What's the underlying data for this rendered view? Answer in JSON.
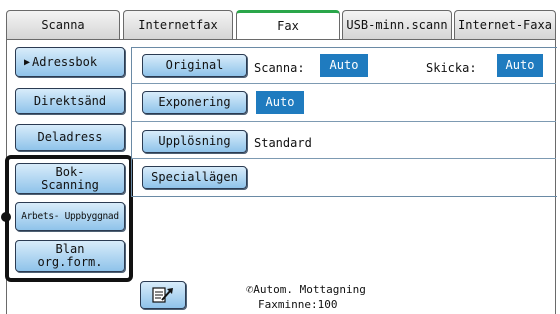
{
  "tabs": [
    "Scanna",
    "Internetfax",
    "Fax",
    "USB-minn.scann",
    "Internet-Faxa"
  ],
  "active_tab": "Fax",
  "left_buttons": {
    "address_book": "Adressbok",
    "direct_send": "Direktsänd",
    "sub_address": "Deladress",
    "book_scanning_1": "Bok-",
    "book_scanning_2": "Scanning",
    "job_build": "Arbets- Uppbyggnad",
    "mixed_1": "Blan",
    "mixed_2": "org.form."
  },
  "settings": {
    "original": {
      "label": "Original",
      "scan_label": "Scanna:",
      "scan_value": "Auto",
      "send_label": "Skicka:",
      "send_value": "Auto"
    },
    "exposure": {
      "label": "Exponering",
      "value": "Auto"
    },
    "resolution": {
      "label": "Upplösning",
      "value": "Standard"
    },
    "special": {
      "label": "Speciallägen"
    }
  },
  "status": {
    "receive": "Autom. Mottagning",
    "memory": "Faxminne:100"
  },
  "colors": {
    "accent": "#1f7bbf",
    "active_tab": "#2aa64a"
  }
}
